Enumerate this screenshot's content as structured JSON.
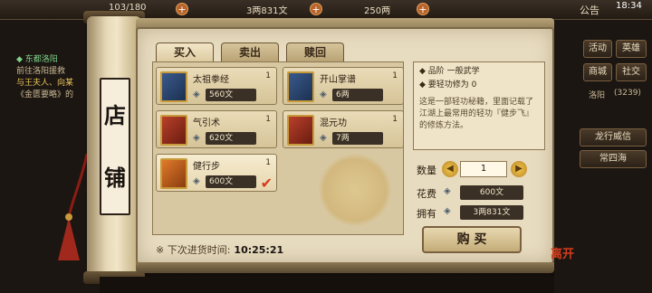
{
  "topbar": {
    "stamina": "103/180",
    "money": "3两831文",
    "gold": "250两",
    "announce": "公告",
    "clock": "18:34"
  },
  "quest": {
    "title": "◆ 东都洛阳",
    "line1": "前往洛阳援救",
    "line2": "与王夫人、向某",
    "line3": "《金匮要略》的"
  },
  "right_panel": {
    "btn1": "活动",
    "btn2": "英雄",
    "btn3": "商城",
    "btn4": "社交",
    "location": "洛阳",
    "coords": "(3239)",
    "btn5": "龙行威信",
    "btn6": "常四海"
  },
  "shop": {
    "sign_char1": "店",
    "sign_char2": "铺",
    "tabs": [
      "买入",
      "卖出",
      "赎回"
    ],
    "items": [
      {
        "name": "太祖拳经",
        "qty": "1",
        "price": "560文",
        "book": "blue"
      },
      {
        "name": "开山掌谱",
        "qty": "1",
        "price": "6两",
        "book": "blue"
      },
      {
        "name": "气引术",
        "qty": "1",
        "price": "620文",
        "book": "red"
      },
      {
        "name": "混元功",
        "qty": "1",
        "price": "7两",
        "book": "red"
      },
      {
        "name": "健行步",
        "qty": "1",
        "price": "600文",
        "book": "orange"
      }
    ],
    "selected_check": "✔",
    "restock_label": "※ 下次进货时间:",
    "restock_time": "10:25:21"
  },
  "detail": {
    "grade": "◆ 品阶  一般武学",
    "req": "◆ 要轻功修为 0",
    "body": "这是一部轻功秘籍，里面记载了江湖上最常用的轻功『健步飞』的修炼方法。",
    "qty_label": "数量",
    "qty_value": "1",
    "cost_label": "花费",
    "cost_value": "600文",
    "own_label": "拥有",
    "own_value": "3两831文",
    "buy_label": "购 买"
  },
  "seal_text": "离开",
  "colors": {
    "parchment": "#e8dcc0",
    "accent_red": "#d43c1c",
    "price_bg": "#3a3026"
  }
}
